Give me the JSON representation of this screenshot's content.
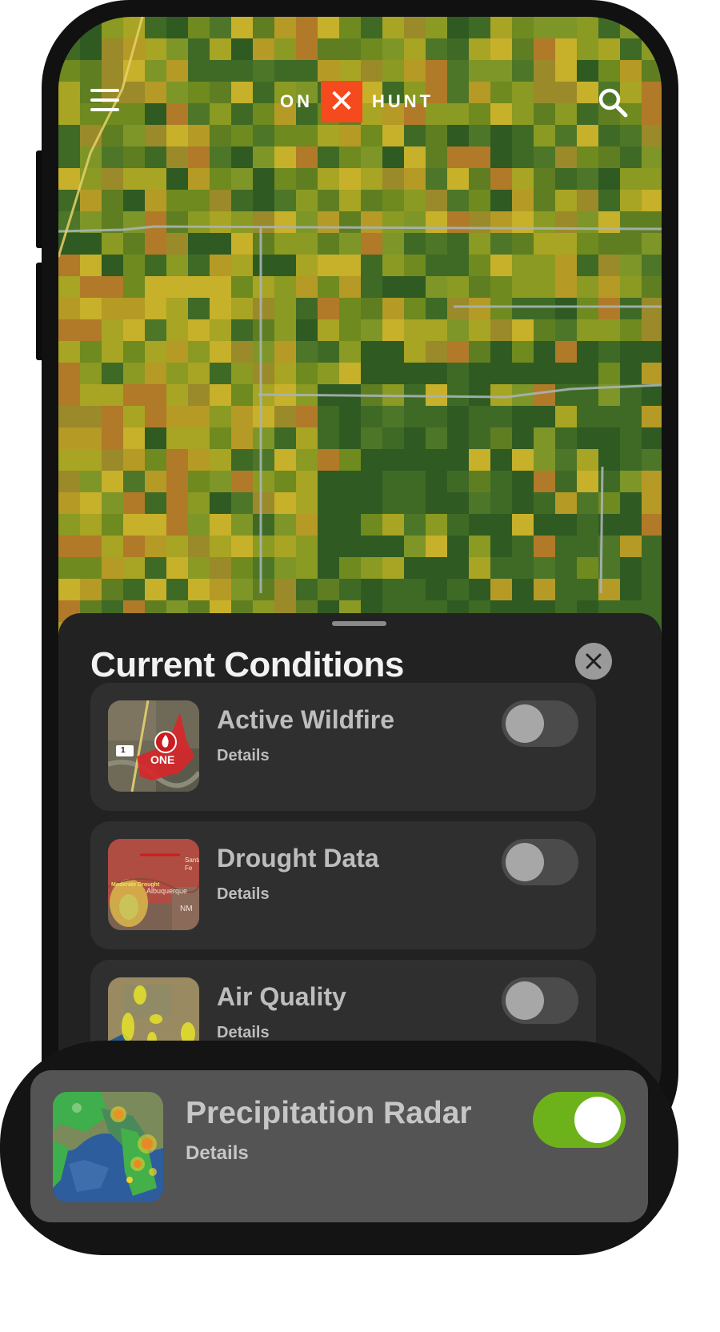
{
  "header": {
    "logo_left": "ON",
    "logo_mark": "✕",
    "logo_right": "HUNT",
    "menu_icon": "hamburger-menu-icon",
    "search_icon": "search-icon"
  },
  "sheet": {
    "title": "Current Conditions",
    "close_icon": "close-icon",
    "layers": [
      {
        "title": "Active Wildfire",
        "details": "Details",
        "enabled": false,
        "thumb_text": "ONE",
        "thumb_road": "1"
      },
      {
        "title": "Drought Data",
        "details": "Details",
        "enabled": false,
        "thumb_text": "Moderate Drought",
        "thumb_city": "Albuquerque",
        "thumb_state": "NM",
        "thumb_city2": "Santa Fe"
      },
      {
        "title": "Air Quality",
        "details": "Details",
        "enabled": false
      }
    ]
  },
  "highlight": {
    "title": "Precipitation Radar",
    "details": "Details",
    "enabled": true
  },
  "colors": {
    "brand": "#f44a1e",
    "toggle_on": "#6db21b",
    "sheet_bg": "#222222"
  }
}
